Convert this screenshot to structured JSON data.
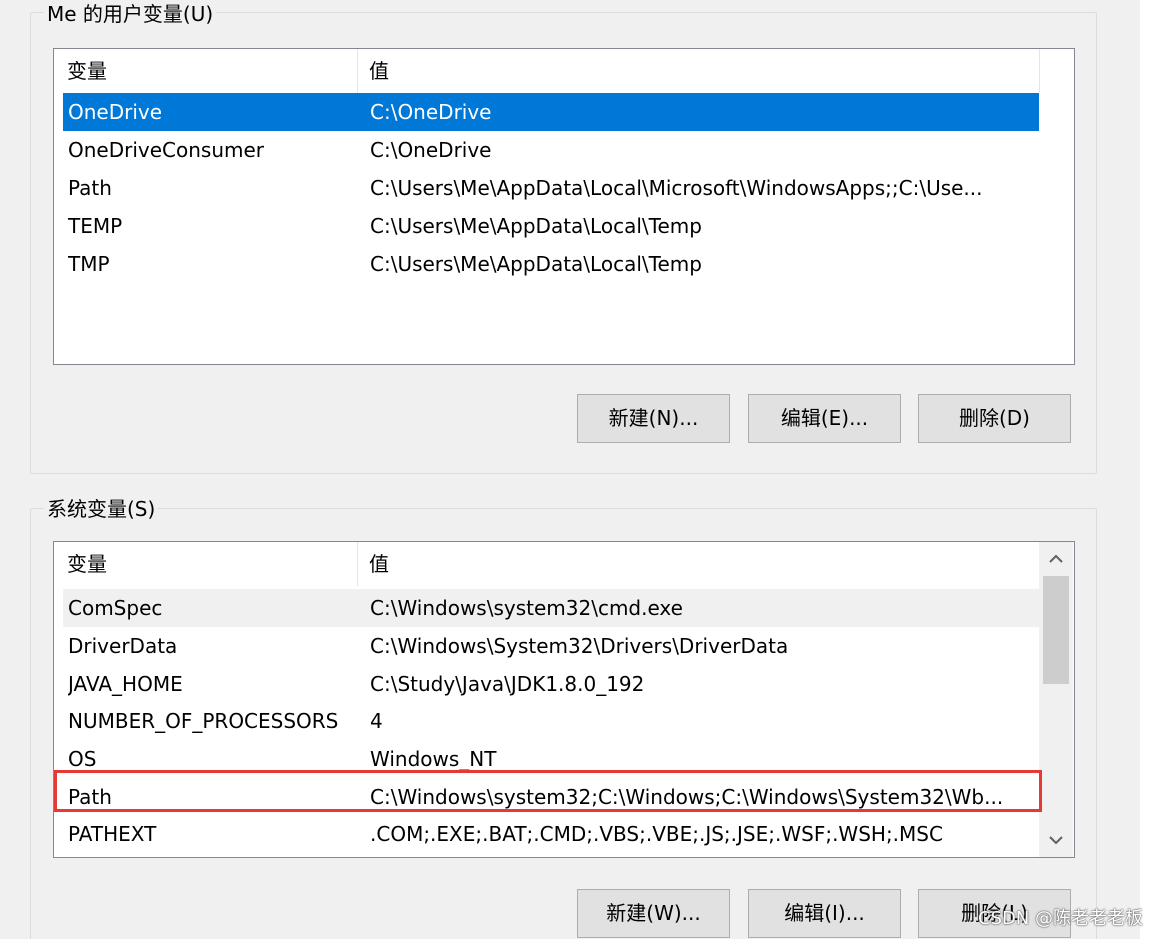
{
  "user_vars": {
    "group_title": "Me 的用户变量(U)",
    "header": {
      "name": "变量",
      "value": "值"
    },
    "rows": [
      {
        "name": "OneDrive",
        "value": "C:\\OneDrive"
      },
      {
        "name": "OneDriveConsumer",
        "value": "C:\\OneDrive"
      },
      {
        "name": "Path",
        "value": "C:\\Users\\Me\\AppData\\Local\\Microsoft\\WindowsApps;;C:\\Use..."
      },
      {
        "name": "TEMP",
        "value": "C:\\Users\\Me\\AppData\\Local\\Temp"
      },
      {
        "name": "TMP",
        "value": "C:\\Users\\Me\\AppData\\Local\\Temp"
      }
    ],
    "selected_row": "OneDrive",
    "buttons": {
      "new": "新建(N)...",
      "edit": "编辑(E)...",
      "delete": "删除(D)"
    }
  },
  "system_vars": {
    "group_title": "系统变量(S)",
    "header": {
      "name": "变量",
      "value": "值"
    },
    "rows": [
      {
        "name": "ComSpec",
        "value": "C:\\Windows\\system32\\cmd.exe"
      },
      {
        "name": "DriverData",
        "value": "C:\\Windows\\System32\\Drivers\\DriverData"
      },
      {
        "name": "JAVA_HOME",
        "value": "C:\\Study\\Java\\JDK1.8.0_192"
      },
      {
        "name": "NUMBER_OF_PROCESSORS",
        "value": "4"
      },
      {
        "name": "OS",
        "value": "Windows_NT"
      },
      {
        "name": "Path",
        "value": "C:\\Windows\\system32;C:\\Windows;C:\\Windows\\System32\\Wb..."
      },
      {
        "name": "PATHEXT",
        "value": ".COM;.EXE;.BAT;.CMD;.VBS;.VBE;.JS;.JSE;.WSF;.WSH;.MSC"
      }
    ],
    "highlighted_row": "Path",
    "scroll": {
      "up_icon": "chevron-up-icon",
      "down_icon": "chevron-down-icon"
    },
    "buttons": {
      "new": "新建(W)...",
      "edit": "编辑(I)...",
      "delete": "删除(L)"
    }
  },
  "watermark": "CSDN @陈老老老板",
  "colors": {
    "selection": "#0078d7",
    "highlight_border": "#e53935",
    "dialog_bg": "#f0f0f0"
  }
}
